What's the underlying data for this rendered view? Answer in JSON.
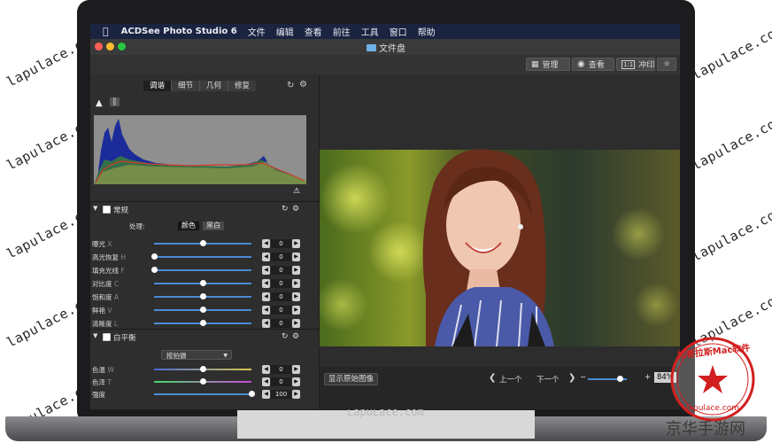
{
  "watermarks": {
    "left": [
      "lapulace.com",
      "lapulace.com",
      "lapulace.com",
      "lapulace.com",
      "lapulace.com"
    ],
    "right": [
      "lapulace.com",
      "lapulace.com",
      "lapulace.com",
      "lapulace.com",
      "lapulace.com"
    ],
    "bottom": "LapuLace.com",
    "site_banner": "京华手游网",
    "stamp_text": "拉普拉斯Mac软件",
    "stamp_url": "lapulace.com"
  },
  "menubar": {
    "app_name": "ACDSee Photo Studio 6",
    "items": [
      "文件",
      "编辑",
      "查看",
      "前往",
      "工具",
      "窗口",
      "帮助"
    ]
  },
  "window": {
    "title": "文件盘",
    "traffic_colors": [
      "#ff5f57",
      "#febc2e",
      "#28c840"
    ]
  },
  "toolbar": {
    "manage": "管理",
    "view": "查看",
    "print": "冲印",
    "print_icon_text": "1:1"
  },
  "panel": {
    "tabs": [
      "调谐",
      "细节",
      "几何",
      "修复"
    ],
    "active_tab": "调谐",
    "general": {
      "title": "常规",
      "process_label": "处理:",
      "modes": [
        "颜色",
        "黑白"
      ],
      "active_mode": "颜色",
      "rows": [
        {
          "label": "曝光",
          "key": "X",
          "value": "0",
          "level": 0.5
        },
        {
          "label": "高光恢复",
          "key": "H",
          "value": "0",
          "level": 0.0
        },
        {
          "label": "填充光线",
          "key": "F",
          "value": "0",
          "level": 0.0
        },
        {
          "label": "对比度",
          "key": "C",
          "value": "0",
          "level": 0.5
        },
        {
          "label": "饱和度",
          "key": "A",
          "value": "0",
          "level": 0.5
        },
        {
          "label": "鲜艳",
          "key": "V",
          "value": "0",
          "level": 0.5
        },
        {
          "label": "清晰度",
          "key": "L",
          "value": "0",
          "level": 0.5
        }
      ]
    },
    "white_balance": {
      "title": "白平衡",
      "dropdown": "按拍摄",
      "rows": [
        {
          "label": "色温",
          "key": "W",
          "value": "0",
          "level": 0.5
        },
        {
          "label": "色泽",
          "key": "T",
          "value": "0",
          "level": 0.5
        },
        {
          "label": "强度",
          "key": "",
          "value": "100",
          "level": 1.0
        }
      ]
    }
  },
  "bottombar": {
    "show_original": "显示原始图像",
    "prev": "上一个",
    "next": "下一个",
    "minus": "−",
    "plus": "+",
    "zoom": "84%",
    "zoom_level": 0.84
  }
}
